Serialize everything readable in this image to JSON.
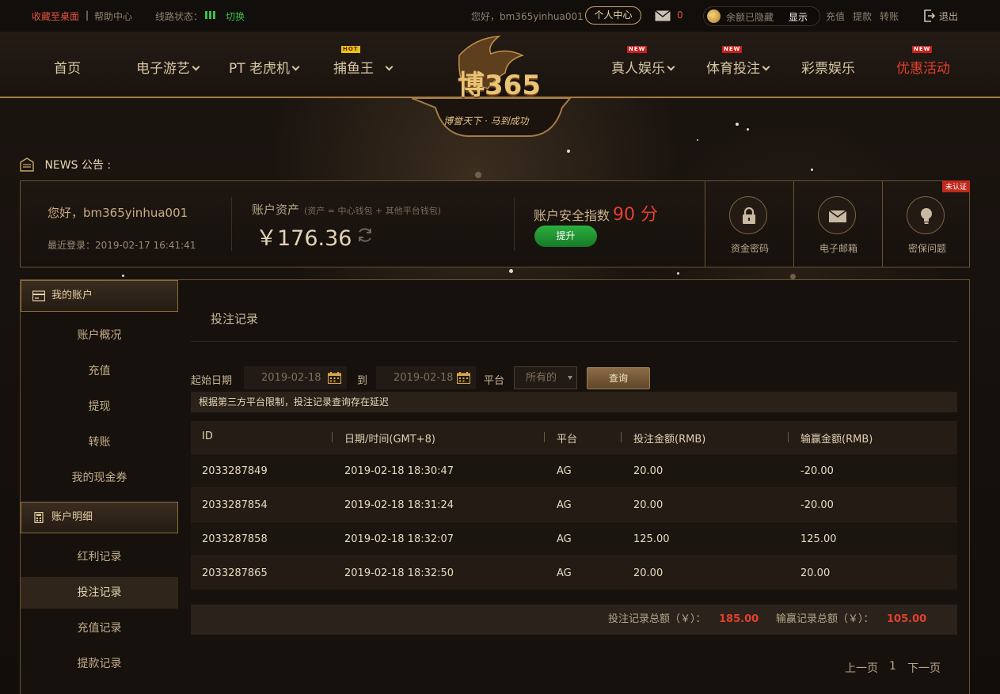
{
  "topbar": {
    "bookmark": "收藏至桌面",
    "divider": "|",
    "help": "帮助中心",
    "line_status_label": "线路状态：",
    "line_switch": "切换",
    "greeting": "您好，bm365yinhua001",
    "personal_center": "个人中心",
    "message_count": "0",
    "balance_hidden": "余额已隐藏",
    "show": "显示",
    "deposit": "充值",
    "withdraw": "提款",
    "transfer": "转账",
    "logout": "退出"
  },
  "nav": {
    "home": "首页",
    "egames": "电子游艺",
    "pt_slots": "PT 老虎机",
    "fishing": "捕鱼王",
    "live": "真人娱乐",
    "sports": "体育投注",
    "lottery": "彩票娱乐",
    "promo": "优惠活动",
    "badge_new": "NEW",
    "badge_hot": "HOT",
    "logo_text": "博365",
    "logo_slogan": "博誉天下 · 马到成功"
  },
  "news": {
    "label": "NEWS 公告 :"
  },
  "account": {
    "greeting": "您好，bm365yinhua001",
    "last_login": "最近登录：2019-02-17 16:41:41",
    "asset_label": "账户资产",
    "asset_note": "(资产 = 中心钱包 + 其他平台钱包)",
    "asset_value": "￥176.36",
    "safety_label": "账户安全指数",
    "safety_score": "90 分",
    "upgrade": "提升",
    "security_items": [
      "资金密码",
      "电子邮箱",
      "密保问题"
    ],
    "unverified": "未认证"
  },
  "sidebar": {
    "my_account": "我的账户",
    "account_items": [
      "账户概况",
      "充值",
      "提现",
      "转账",
      "我的现金券"
    ],
    "account_details": "账户明细",
    "detail_items": [
      "红利记录",
      "投注记录",
      "充值记录",
      "提款记录"
    ]
  },
  "main": {
    "title": "投注记录",
    "start_date_label": "起始日期",
    "start_date": "2019-02-18",
    "to_label": "到",
    "end_date": "2019-02-18",
    "platform_label": "平台",
    "platform_value": "所有的",
    "query": "查询",
    "notice": "根据第三方平台限制，投注记录查询存在延迟",
    "columns": [
      "ID",
      "日期/时间(GMT+8)",
      "平台",
      "投注金额(RMB)",
      "输赢金额(RMB)"
    ],
    "rows": [
      [
        "2033287849",
        "2019-02-18 18:30:47",
        "AG",
        "20.00",
        "-20.00"
      ],
      [
        "2033287854",
        "2019-02-18 18:31:24",
        "AG",
        "20.00",
        "-20.00"
      ],
      [
        "2033287858",
        "2019-02-18 18:32:07",
        "AG",
        "125.00",
        "125.00"
      ],
      [
        "2033287865",
        "2019-02-18 18:32:50",
        "AG",
        "20.00",
        "20.00"
      ]
    ],
    "bet_total_label": "投注记录总额（￥）：",
    "bet_total": "185.00",
    "win_total_label": "输赢记录总额（￥）：",
    "win_total": "105.00",
    "prev_page": "上一页",
    "page_num": "1",
    "next_page": "下一页"
  },
  "colors": {
    "accent_gold": "#c9a56a",
    "alert_red": "#e3402e",
    "status_green": "#37c24a",
    "background": "#17110d"
  }
}
